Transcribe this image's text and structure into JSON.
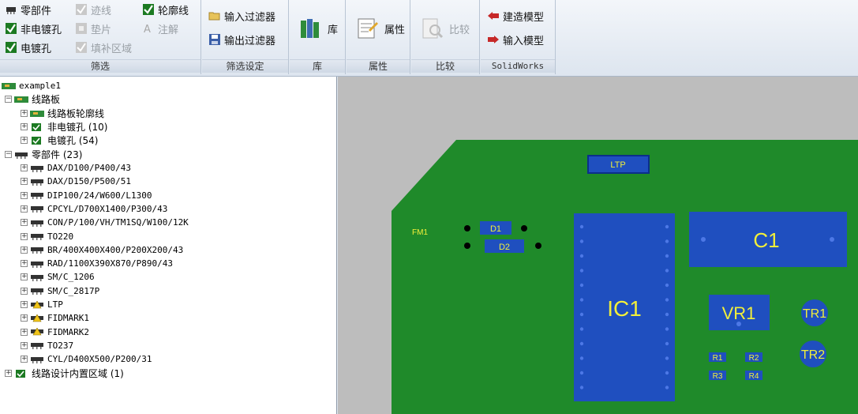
{
  "ribbon": {
    "filter": {
      "items": [
        "零部件",
        "非电镀孔",
        "电镀孔",
        "迹线",
        "垫片",
        "填补区域",
        "轮廓线",
        "注解"
      ],
      "label": "筛选"
    },
    "filter_settings": {
      "import": "输入过滤器",
      "export": "输出过滤器",
      "label": "筛选设定"
    },
    "library": {
      "button": "库",
      "label": "库"
    },
    "properties": {
      "button": "属性",
      "label": "属性"
    },
    "compare": {
      "button": "比较",
      "label": "比较"
    },
    "solidworks": {
      "build": "建造模型",
      "import": "输入模型",
      "label": "SolidWorks"
    }
  },
  "tree": {
    "root": "example1",
    "board": {
      "label": "线路板",
      "children": [
        "线路板轮廓线",
        "非电镀孔 (10)",
        "电镀孔 (54)"
      ]
    },
    "components": {
      "label": "零部件 (23)",
      "children": [
        "DAX/D100/P400/43",
        "DAX/D150/P500/51",
        "DIP100/24/W600/L1300",
        "CPCYL/D700X1400/P300/43",
        "CON/P/100/VH/TM1SQ/W100/12K",
        "TO220",
        "BR/400X400X400/P200X200/43",
        "RAD/1100X390X870/P890/43",
        "SM/C_1206",
        "SM/C_2817P",
        "LTP",
        "FIDMARK1",
        "FIDMARK2",
        "TO237",
        "CYL/D400X500/P200/31"
      ]
    },
    "keepin": "线路设计内置区域 (1)"
  },
  "board": {
    "labels": {
      "ltp": "LTP",
      "fm1": "FM1",
      "d1": "D1",
      "d2": "D2",
      "ic1": "IC1",
      "c1": "C1",
      "vr1": "VR1",
      "tr1": "TR1",
      "tr2": "TR2",
      "r1": "R1",
      "r2": "R2",
      "r3": "R3",
      "r4": "R4"
    },
    "colors": {
      "board": "#1f8a2a",
      "component": "#1f4fbf",
      "text": "#f2ef3a",
      "background": "#bdbdbd"
    }
  }
}
